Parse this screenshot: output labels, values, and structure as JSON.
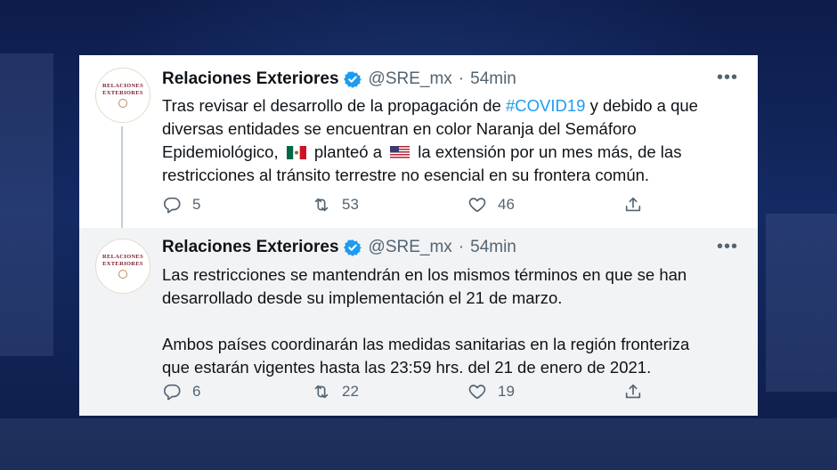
{
  "tweets": [
    {
      "author": "Relaciones Exteriores",
      "handle": "@SRE_mx",
      "separator": "·",
      "time": "54min",
      "avatar_text": [
        "RELACIONES",
        "EXTERIORES"
      ],
      "text_parts": [
        "Tras revisar el desarrollo de la propagación de ",
        "#COVID19",
        " y debido a que\ndiversas entidades se encuentran en color Naranja del Semáforo\nEpidemiológico, ",
        " planteó a ",
        " la extensión por un mes más, de las\nrestricciones al tránsito terrestre no esencial en su frontera común."
      ],
      "flags": [
        "mexico-flag",
        "usa-flag"
      ],
      "replies": "5",
      "retweets": "53",
      "likes": "46"
    },
    {
      "author": "Relaciones Exteriores",
      "handle": "@SRE_mx",
      "separator": "·",
      "time": "54min",
      "avatar_text": [
        "RELACIONES",
        "EXTERIORES"
      ],
      "text": "Las restricciones se mantendrán en los mismos términos en que se han\ndesarrollado desde su implementación el 21 de marzo.\n\nAmbos países coordinarán las medidas sanitarias en la región fronteriza\nque estarán vigentes hasta las 23:59 hrs. del 21 de enero de 2021.",
      "replies": "6",
      "retweets": "22",
      "likes": "19"
    }
  ],
  "icons": {
    "more": "more-icon",
    "verified": "verified-badge-icon",
    "reply": "reply-icon",
    "retweet": "retweet-icon",
    "like": "heart-icon",
    "share": "share-icon"
  },
  "colors": {
    "link": "#1d9bf0",
    "verified": "#1d9bf0",
    "muted": "#536471",
    "background": "#0d1c4a"
  }
}
